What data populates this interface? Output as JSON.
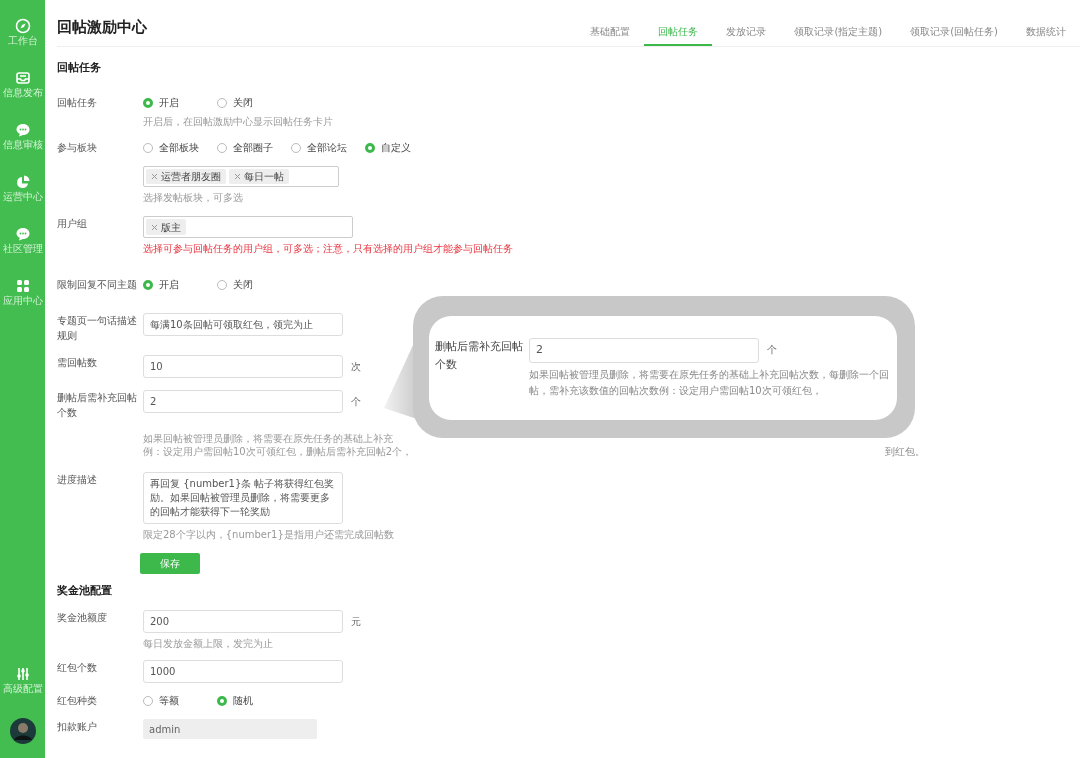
{
  "sidebar": {
    "items": [
      {
        "label": "工作台"
      },
      {
        "label": "信息发布"
      },
      {
        "label": "信息审核"
      },
      {
        "label": "运营中心"
      },
      {
        "label": "社区管理"
      },
      {
        "label": "应用中心"
      }
    ],
    "bottom_items": [
      {
        "label": "高级配置"
      }
    ]
  },
  "page": {
    "title": "回帖激励中心"
  },
  "tabs": [
    {
      "label": "基础配置",
      "selected": false
    },
    {
      "label": "回帖任务",
      "selected": true
    },
    {
      "label": "发放记录",
      "selected": false
    },
    {
      "label": "领取记录(指定主题)",
      "selected": false
    },
    {
      "label": "领取记录(回帖任务)",
      "selected": false
    },
    {
      "label": "数据统计",
      "selected": false
    }
  ],
  "sections": [
    {
      "title": "回帖任务",
      "fields": [
        {
          "kind": "radio",
          "label": "回帖任务",
          "options": [
            {
              "label": "开启",
              "selected": true
            },
            {
              "label": "关闭",
              "selected": false
            }
          ],
          "help": "开启后，在回帖激励中心显示回帖任务卡片",
          "help_alert": false
        },
        {
          "kind": "radio",
          "label": "参与板块",
          "options": [
            {
              "label": "全部板块",
              "selected": false
            },
            {
              "label": "全部圈子",
              "selected": false
            },
            {
              "label": "全部论坛",
              "selected": false
            },
            {
              "label": "自定义",
              "selected": true
            }
          ]
        },
        {
          "kind": "tags",
          "tags": [
            "运营者朋友圈",
            "每日一帖"
          ],
          "help": "选择发帖板块，可多选",
          "help_alert": false
        },
        {
          "kind": "tags",
          "label": "用户组",
          "tags": [
            "版主"
          ],
          "help": "选择可参与回帖任务的用户组，可多选；注意，只有选择的用户组才能参与回帖任务",
          "help_alert": true
        },
        {
          "kind": "radio",
          "label": "限制回复不同主题",
          "options": [
            {
              "label": "开启",
              "selected": true
            },
            {
              "label": "关闭",
              "selected": false
            }
          ]
        },
        {
          "kind": "text",
          "label": "专题页一句话描述规则",
          "value": "每满10条回帖可领取红包，领完为止"
        },
        {
          "kind": "text",
          "label": "需回帖数",
          "value": "10",
          "unit": "次"
        },
        {
          "kind": "text",
          "label": "删帖后需补充回帖个数",
          "value": "2",
          "unit": "个",
          "help_lines": [
            "如果回帖被管理员删除，将需要在原先任务的基础上补充",
            "例：设定用户需回帖10次可领红包，删帖后需补充回帖2个，"
          ],
          "help_tail": "到红包。"
        },
        {
          "kind": "textarea",
          "label": "进度描述",
          "value": "再回复 {number1}条 帖子将获得红包奖励。如果回帖被管理员删除，将需要更多的回帖才能获得下一轮奖励",
          "help": "限定28个字以内，{number1}是指用户还需完成回帖数",
          "help_alert": false
        }
      ],
      "save_button": "保存"
    },
    {
      "title": "奖金池配置",
      "fields": [
        {
          "kind": "text",
          "label": "奖金池额度",
          "value": "200",
          "unit": "元",
          "help": "每日发放金额上限，发完为止",
          "help_alert": false
        },
        {
          "kind": "text",
          "label": "红包个数",
          "value": "1000"
        },
        {
          "kind": "radio",
          "label": "红包种类",
          "options": [
            {
              "label": "等额",
              "selected": false
            },
            {
              "label": "随机",
              "selected": true
            }
          ]
        },
        {
          "kind": "select",
          "label": "扣款账户",
          "value": "admin"
        }
      ]
    }
  ],
  "callout": {
    "label": "删帖后需补充回帖个数",
    "value": "2",
    "unit": "个",
    "help": "如果回帖被管理员删除，将需要在原先任务的基础上补充回帖次数，每删除一个回帖，需补充该数值的回帖次数例：设定用户需回帖10次可领红包，"
  }
}
